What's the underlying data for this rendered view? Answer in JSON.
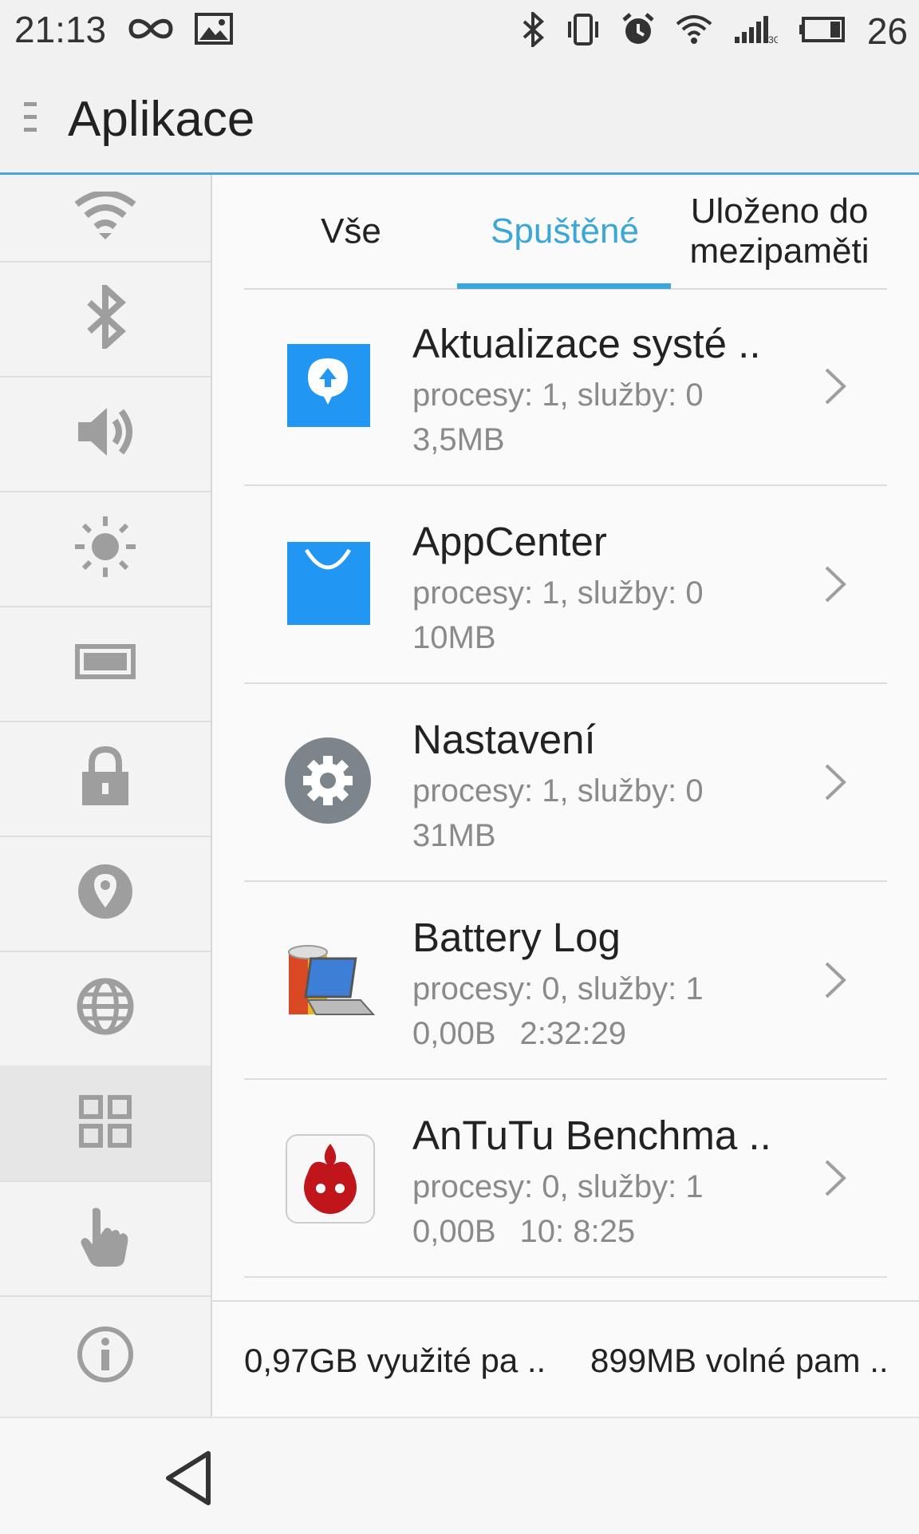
{
  "status_bar": {
    "time": "21:13",
    "battery_level": "26",
    "network_type": "3G",
    "icons": [
      "infinity-icon",
      "image-icon",
      "bluetooth-icon",
      "vibrate-icon",
      "alarm-icon",
      "wifi-icon",
      "signal-icon",
      "battery-icon"
    ]
  },
  "header": {
    "title": "Aplikace",
    "menu_icon": "menu-icon"
  },
  "sidebar": {
    "items": [
      {
        "icon": "wifi-icon",
        "active": false
      },
      {
        "icon": "bluetooth-icon",
        "active": false
      },
      {
        "icon": "volume-icon",
        "active": false
      },
      {
        "icon": "brightness-icon",
        "active": false
      },
      {
        "icon": "battery-icon",
        "active": false
      },
      {
        "icon": "lock-icon",
        "active": false
      },
      {
        "icon": "location-icon",
        "active": false
      },
      {
        "icon": "globe-icon",
        "active": false
      },
      {
        "icon": "apps-grid-icon",
        "active": true
      },
      {
        "icon": "hand-gesture-icon",
        "active": false
      },
      {
        "icon": "info-icon",
        "active": false
      }
    ]
  },
  "tabs": [
    {
      "label": "Vše",
      "active": false
    },
    {
      "label": "Spuštěné",
      "active": true
    },
    {
      "label": "Uloženo do mezipaměti",
      "active": false
    }
  ],
  "apps": [
    {
      "name": "Aktualizace systé ..",
      "processes": "procesy: 1, služby: 0",
      "size": "3,5MB",
      "time": "",
      "icon": "system-update-icon",
      "accent": "#2196f3"
    },
    {
      "name": "AppCenter",
      "processes": "procesy: 1, služby: 0",
      "size": "10MB",
      "time": "",
      "icon": "appcenter-bag-icon",
      "accent": "#2196f3"
    },
    {
      "name": "Nastavení",
      "processes": "procesy: 1, služby: 0",
      "size": "31MB",
      "time": "",
      "icon": "settings-gear-icon",
      "accent": "#7d858c"
    },
    {
      "name": "Battery Log",
      "processes": "procesy: 0, služby: 1",
      "size": "0,00B",
      "time": "2:32:29",
      "icon": "battery-log-icon",
      "accent": "#f0b020"
    },
    {
      "name": "AnTuTu Benchma ..",
      "processes": "procesy: 0, služby: 1",
      "size": "0,00B",
      "time": "10: 8:25",
      "icon": "antutu-icon",
      "accent": "#c0151b"
    }
  ],
  "memory": {
    "used": "0,97GB využité pa ..",
    "free": "899MB volné pam .."
  },
  "navbar": {
    "back_icon": "back-icon"
  },
  "colors": {
    "accent": "#3aa7d8",
    "text": "#222222",
    "secondary_text": "#8a8a8a",
    "icon_gray": "#9e9e9e"
  }
}
